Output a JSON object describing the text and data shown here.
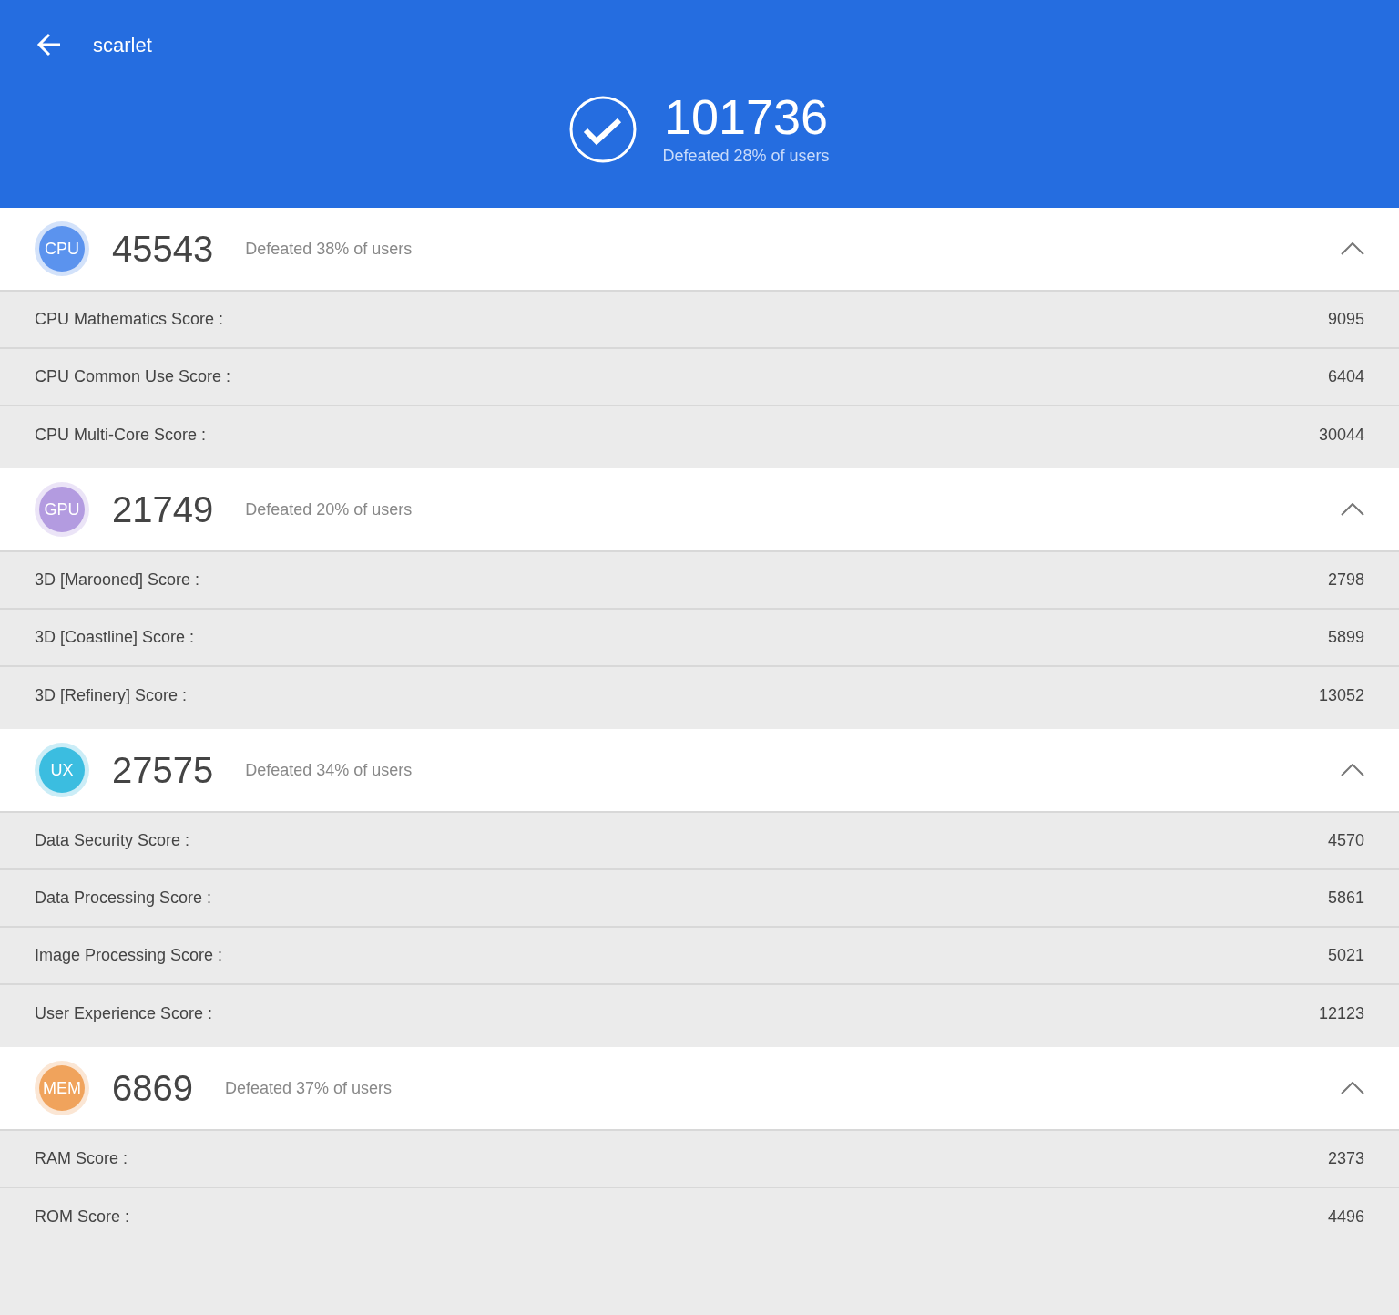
{
  "header": {
    "title": "scarlet",
    "total_score": "101736",
    "defeated": "Defeated 28% of users"
  },
  "sections": [
    {
      "badge": "CPU",
      "color": "#5b93ee",
      "score": "45543",
      "defeated": "Defeated 38% of users",
      "expanded": true,
      "rows": [
        {
          "label": "CPU Mathematics Score :",
          "value": "9095"
        },
        {
          "label": "CPU Common Use Score :",
          "value": "6404"
        },
        {
          "label": "CPU Multi-Core Score :",
          "value": "30044"
        }
      ]
    },
    {
      "badge": "GPU",
      "color": "#b39be0",
      "score": "21749",
      "defeated": "Defeated 20% of users",
      "expanded": true,
      "rows": [
        {
          "label": "3D [Marooned] Score :",
          "value": "2798"
        },
        {
          "label": "3D [Coastline] Score :",
          "value": "5899"
        },
        {
          "label": "3D [Refinery] Score :",
          "value": "13052"
        }
      ]
    },
    {
      "badge": "UX",
      "color": "#3bbde0",
      "score": "27575",
      "defeated": "Defeated 34% of users",
      "expanded": true,
      "rows": [
        {
          "label": "Data Security Score :",
          "value": "4570"
        },
        {
          "label": "Data Processing Score :",
          "value": "5861"
        },
        {
          "label": "Image Processing Score :",
          "value": "5021"
        },
        {
          "label": "User Experience Score :",
          "value": "12123"
        }
      ]
    },
    {
      "badge": "MEM",
      "color": "#f0a35c",
      "score": "6869",
      "defeated": "Defeated 37% of users",
      "expanded": true,
      "rows": [
        {
          "label": "RAM Score :",
          "value": "2373"
        },
        {
          "label": "ROM Score :",
          "value": "4496"
        }
      ]
    }
  ]
}
